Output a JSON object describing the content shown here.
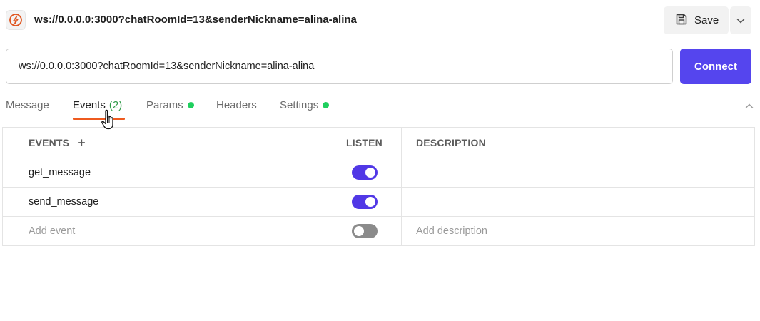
{
  "header": {
    "title": "ws://0.0.0.0:3000?chatRoomId=13&senderNickname=alina-alina",
    "save_label": "Save"
  },
  "url_bar": {
    "value": "ws://0.0.0.0:3000?chatRoomId=13&senderNickname=alina-alina",
    "connect_label": "Connect"
  },
  "tabs": [
    {
      "label": "Message"
    },
    {
      "label": "Events",
      "count": "(2)",
      "active": true
    },
    {
      "label": "Params",
      "indicator": "green-dot"
    },
    {
      "label": "Headers"
    },
    {
      "label": "Settings",
      "indicator": "green-dot"
    }
  ],
  "events_table": {
    "headers": {
      "events": "EVENTS",
      "listen": "LISTEN",
      "description": "DESCRIPTION"
    },
    "rows": [
      {
        "event": "get_message",
        "listen": true,
        "description": ""
      },
      {
        "event": "send_message",
        "listen": true,
        "description": ""
      }
    ],
    "new_row": {
      "event_placeholder": "Add event",
      "listen": false,
      "description_placeholder": "Add description"
    }
  },
  "icons": [
    "websocket-logo-icon",
    "save-icon",
    "chevron-down-icon",
    "plus-icon",
    "chevron-up-icon",
    "hand-pointer-cursor-icon"
  ],
  "colors": {
    "accent": "#5545ee",
    "active_tab_underline": "#ee5a1f",
    "status_dot": "#1fcf5e",
    "count": "#2e9a47"
  }
}
